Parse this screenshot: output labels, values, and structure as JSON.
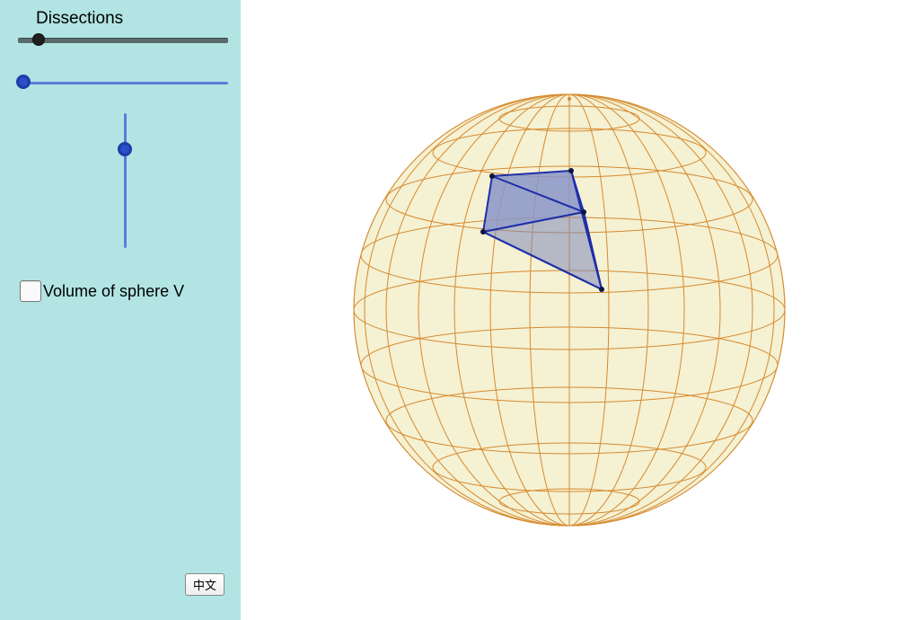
{
  "sidebar": {
    "title": "Dissections",
    "slider1": {
      "min": 0,
      "max": 100,
      "value": 8
    },
    "slider2": {
      "min": 0,
      "max": 100,
      "value": 0
    },
    "slider3": {
      "min": 0,
      "max": 100,
      "value": 22
    },
    "checkbox": {
      "checked": false,
      "label": "Volume of sphere V"
    },
    "language_button": "中文"
  },
  "scene": {
    "object": "sphere-wireframe",
    "sphere_color": "#f5f1d3",
    "grid_color": "#d68a2e",
    "pyramid_fill": "#8a95c8",
    "pyramid_edge": "#1e2ea9",
    "longitudes": 12,
    "latitudes": 8,
    "pyramid": {
      "description": "quad-based pyramid from sphere center to surface patch, upper-left front of sphere",
      "apex": "center",
      "base_on_surface": true
    }
  }
}
